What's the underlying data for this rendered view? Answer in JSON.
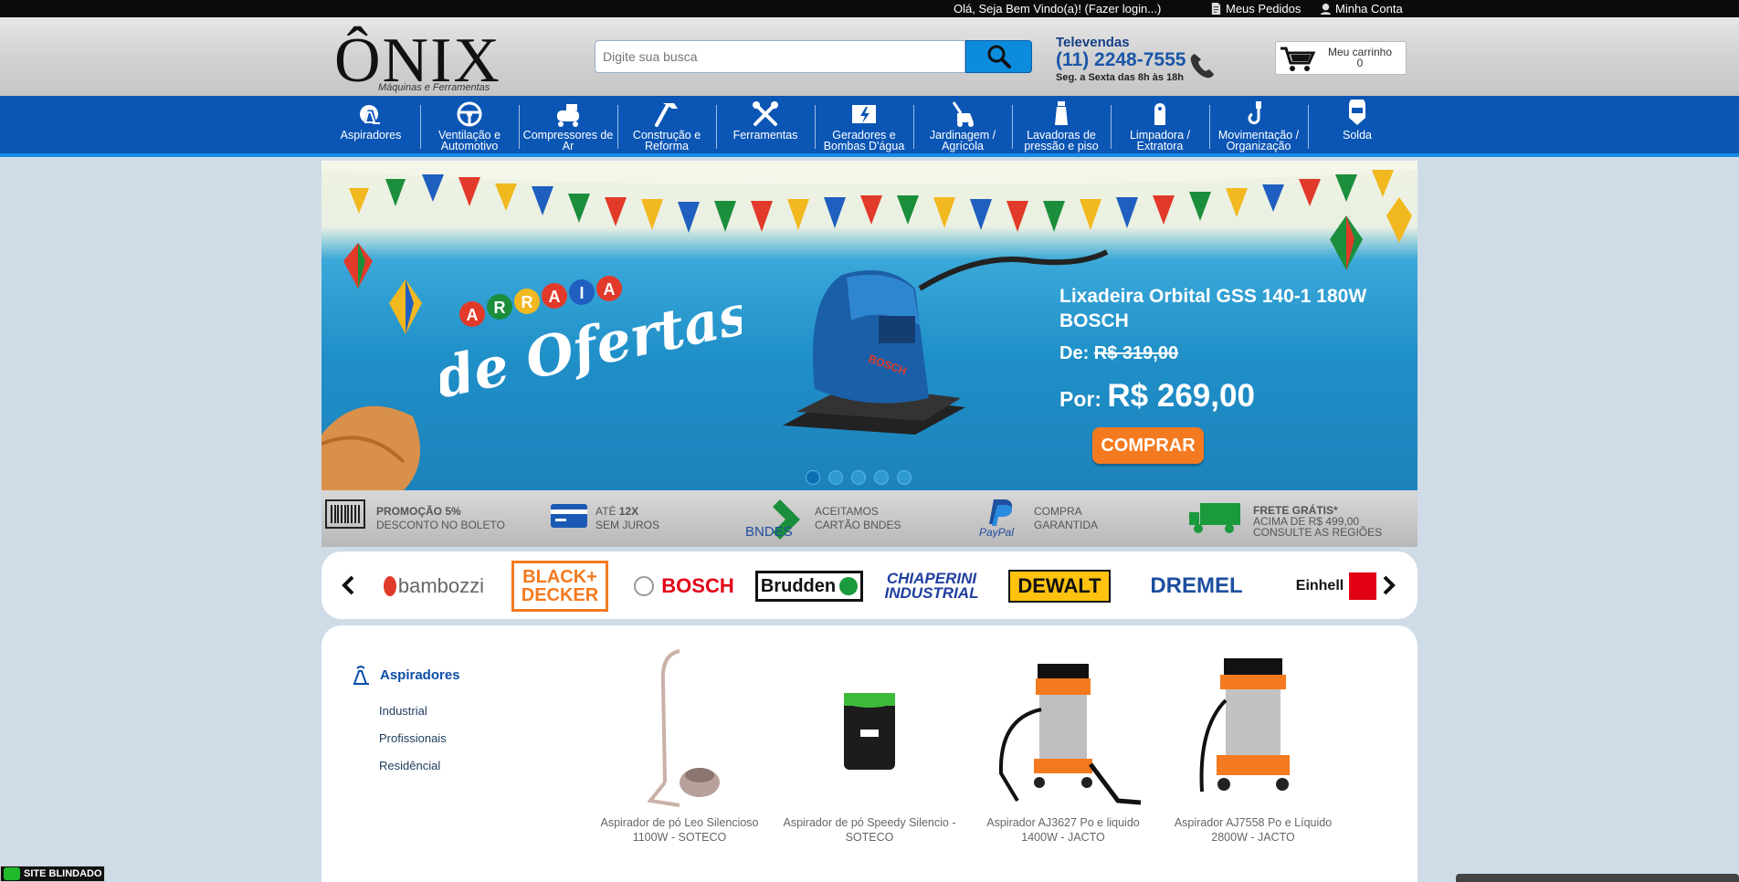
{
  "topbar": {
    "welcome": "Olá, Seja Bem Vindo(a)! (Fazer login...)",
    "orders": "Meus Pedidos",
    "account": "Minha Conta"
  },
  "header": {
    "logo_text": "ÔNIX",
    "logo_tagline": "Máquinas e Ferramentas",
    "search_placeholder": "Digite sua busca",
    "tele_label": "Televendas",
    "tele_number": "(11) 2248-7555",
    "tele_hours": "Seg. a Sexta das 8h às 18h",
    "cart_label": "Meu carrinho",
    "cart_count": "0"
  },
  "nav": {
    "items": [
      {
        "label": "Aspiradores",
        "icon": "vacuum-icon"
      },
      {
        "label": "Ventilação e Automotivo",
        "icon": "steering-wheel-icon"
      },
      {
        "label": "Compressores de Ar",
        "icon": "compressor-icon"
      },
      {
        "label": "Construção e Reforma",
        "icon": "hammer-icon"
      },
      {
        "label": "Ferramentas",
        "icon": "tools-icon"
      },
      {
        "label": "Geradores e Bombas D'água",
        "icon": "generator-icon"
      },
      {
        "label": "Jardinagem / Agrícola",
        "icon": "lawnmower-icon"
      },
      {
        "label": "Lavadoras de pressão e piso",
        "icon": "pressure-washer-icon"
      },
      {
        "label": "Limpadora / Extratora",
        "icon": "extractor-icon"
      },
      {
        "label": "Movimentação / Organização",
        "icon": "hook-icon"
      },
      {
        "label": "Solda",
        "icon": "welding-mask-icon"
      }
    ]
  },
  "banner": {
    "headline_top": "ARRAIA",
    "headline_bottom": "de Ofertas",
    "product": "Lixadeira Orbital GSS 140-1 180W BOSCH",
    "from_label": "De:",
    "from_price": "R$ 319,00",
    "by_label": "Por:",
    "by_price": "R$ 269,00",
    "buy_label": "COMPRAR",
    "dot_count": 5,
    "active_dot": 0
  },
  "benefits": [
    {
      "title": "PROMOÇÃO 5%",
      "text": "DESCONTO NO BOLETO",
      "icon": "barcode-icon"
    },
    {
      "title_prefix": "ATÉ ",
      "title": "12X",
      "text": "SEM JUROS",
      "icon": "credit-card-icon"
    },
    {
      "title": "ACEITAMOS",
      "text": "CARTÃO BNDES",
      "icon": "bndes-icon",
      "logo_text": "BNDES"
    },
    {
      "title": "COMPRA",
      "text": "GARANTIDA",
      "icon": "paypal-icon",
      "logo_text": "PayPal"
    },
    {
      "title": "FRETE GRÁTIS*",
      "text": "ACIMA DE R$ 499,00",
      "text2": "CONSULTE AS REGIÕES",
      "icon": "truck-icon"
    }
  ],
  "brands": [
    "bambozzi",
    "BLACK+ DECKER",
    "BOSCH",
    "Brudden",
    "CHIAPERINI INDUSTRIAL",
    "DEWALT",
    "DREMEL",
    "Einhell"
  ],
  "category": {
    "title": "Aspiradores",
    "subcategories": [
      "Industrial",
      "Profissionais",
      "Residêncial"
    ]
  },
  "products": [
    {
      "name": "Aspirador de pó Leo Silencioso 1100W - SOTECO"
    },
    {
      "name": "Aspirador de pó Speedy Silencio - SOTECO"
    },
    {
      "name": "Aspirador AJ3627 Po e liquido 1400W - JACTO"
    },
    {
      "name": "Aspirador AJ7558 Po e Líquido 2800W - JACTO"
    }
  ],
  "badge": {
    "label": "SITE BLINDADO"
  },
  "colors": {
    "nav_blue": "#0b56b5",
    "accent_blue": "#0d8cdd",
    "buy_orange": "#f47a1f",
    "page_bg": "#cfdce8"
  }
}
